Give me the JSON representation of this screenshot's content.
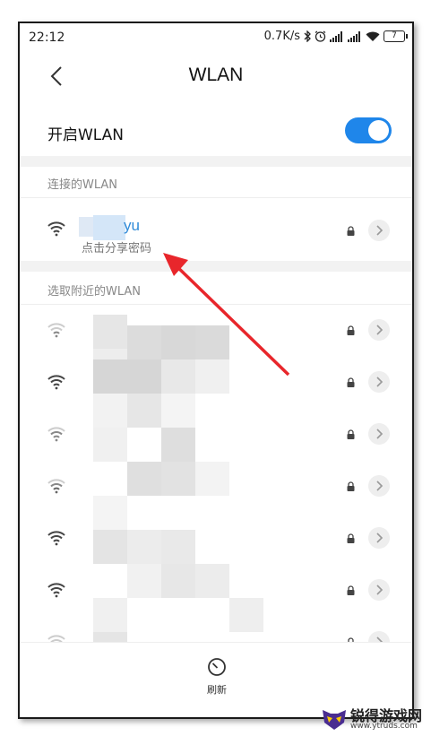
{
  "statusbar": {
    "time": "22:12",
    "speed": "0.7K/s",
    "battery": "7"
  },
  "header": {
    "title": "WLAN"
  },
  "wlan_toggle": {
    "label": "开启WLAN",
    "on": true
  },
  "connected": {
    "section_title": "连接的WLAN",
    "ssid": "yu",
    "hint": "点击分享密码"
  },
  "nearby": {
    "section_title": "选取附近的WLAN"
  },
  "bottom": {
    "refresh_label": "刷新"
  },
  "watermark": {
    "name": "锐得游戏网",
    "url": "www.ytruds.com"
  },
  "colors": {
    "accent": "#1f86ea",
    "arrow": "#e8262b"
  }
}
